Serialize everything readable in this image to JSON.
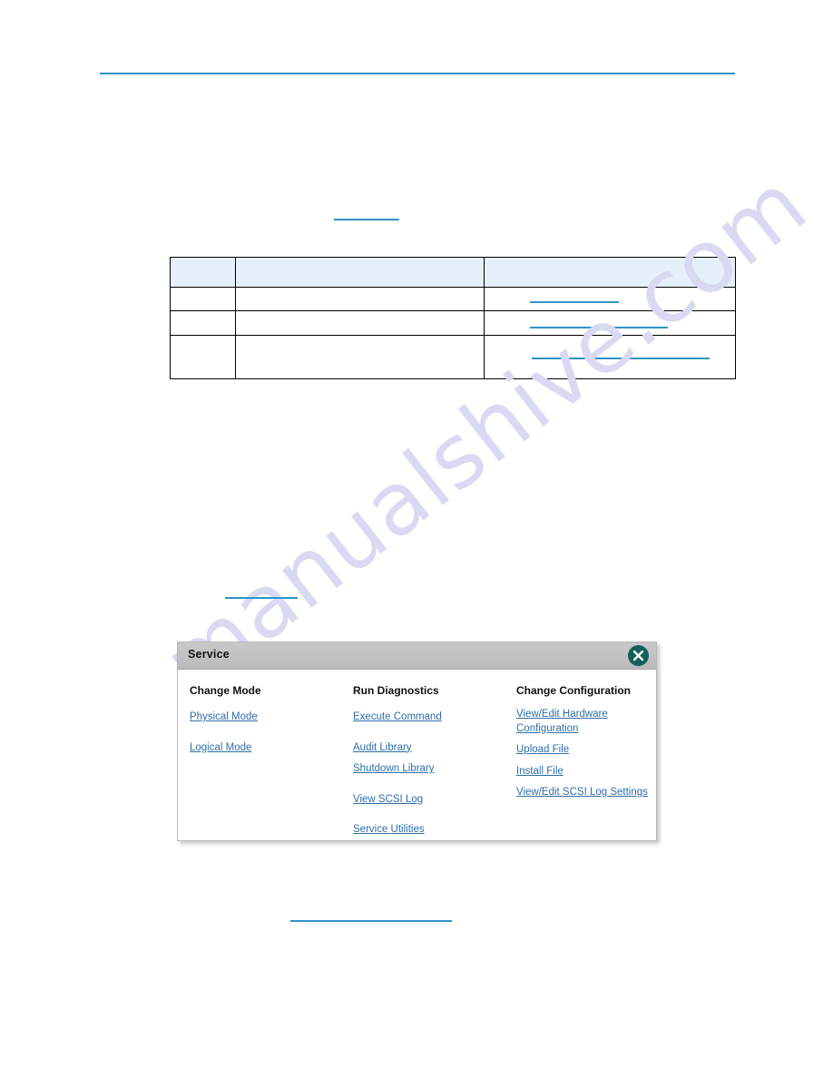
{
  "page": {
    "background_color": "#fffffe",
    "watermark_text": "manualshive.com",
    "watermark_color": "#d9d9f2",
    "rule_color": "#2f93c8",
    "link_color": "#2e6da8"
  },
  "table": {
    "header_fill": "#e6f0fa",
    "columns": [
      "",
      "",
      ""
    ],
    "rows": [
      {
        "cells": [
          "",
          "",
          ""
        ]
      },
      {
        "cells": [
          "",
          "",
          ""
        ]
      },
      {
        "cells": [
          "",
          "",
          ""
        ]
      }
    ]
  },
  "dialog": {
    "title": "Service",
    "close_icon": "close-icon",
    "titlebar_color": "#c2c2c2",
    "close_button_color": "#15605c",
    "columns": [
      {
        "title": "Change Mode",
        "links": [
          "Physical Mode",
          "Logical Mode"
        ]
      },
      {
        "title": "Run Diagnostics",
        "links": [
          "Execute Command",
          "Audit Library",
          "Shutdown Library",
          "View SCSI Log",
          "Service Utilities"
        ]
      },
      {
        "title": "Change Configuration",
        "links": [
          "View/Edit Hardware Configuration",
          "Upload File",
          "Install File",
          "View/Edit SCSI Log Settings"
        ]
      }
    ]
  }
}
